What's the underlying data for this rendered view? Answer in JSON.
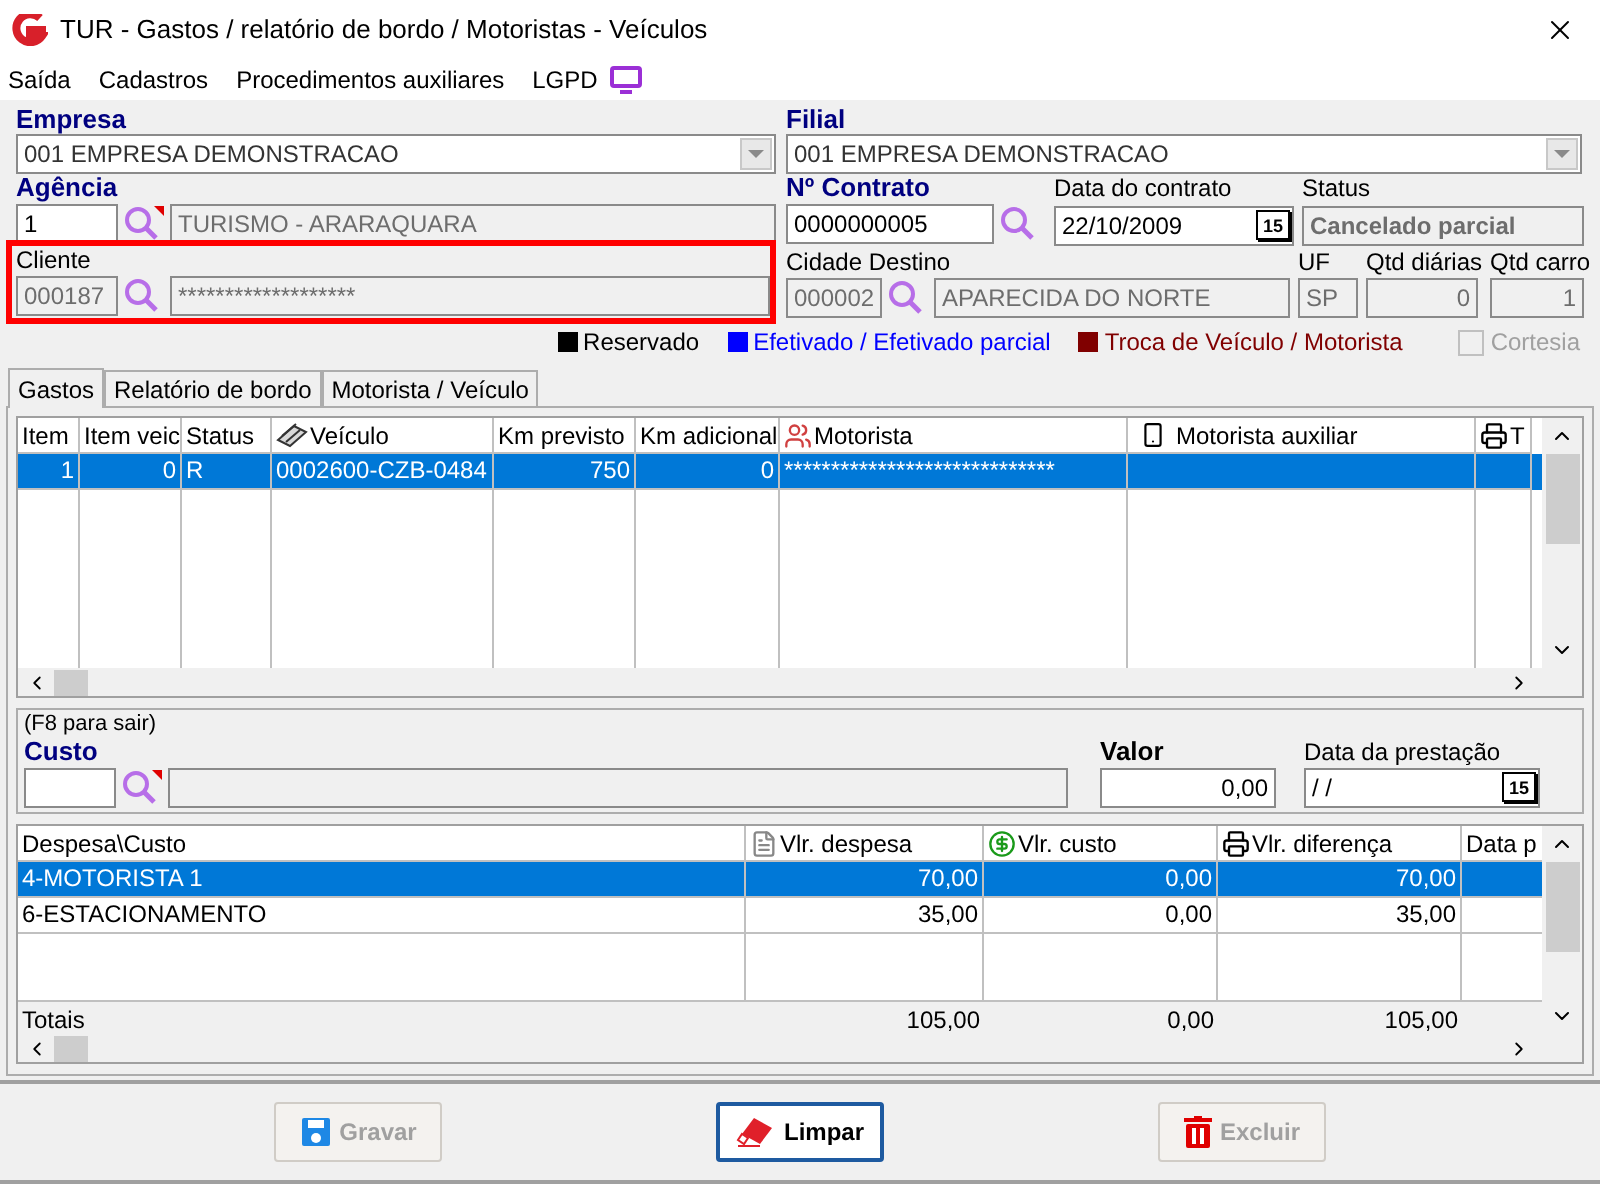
{
  "window": {
    "title": "TUR - Gastos / relatório de bordo / Motoristas - Veículos"
  },
  "menu": [
    {
      "label": "Saída"
    },
    {
      "label": "Cadastros"
    },
    {
      "label": "Procedimentos auxiliares"
    },
    {
      "label": "LGPD"
    }
  ],
  "empresa": {
    "label": "Empresa",
    "value": "001 EMPRESA DEMONSTRACAO"
  },
  "filial": {
    "label": "Filial",
    "value": "001 EMPRESA DEMONSTRACAO"
  },
  "agencia": {
    "label": "Agência",
    "code": "1",
    "name": "TURISMO - ARARAQUARA"
  },
  "contrato": {
    "label": "Nº Contrato",
    "value": "0000000005"
  },
  "data_contrato": {
    "label": "Data do contrato",
    "value": "22/10/2009",
    "calendar": "15"
  },
  "status": {
    "label": "Status",
    "value": "Cancelado parcial"
  },
  "cliente": {
    "label": "Cliente",
    "code": "000187",
    "name": "*******************"
  },
  "cidade_destino": {
    "label": "Cidade Destino",
    "code": "000002",
    "name": "APARECIDA DO NORTE"
  },
  "uf": {
    "label": "UF",
    "value": "SP"
  },
  "qtd_diarias": {
    "label": "Qtd diárias",
    "value": "0"
  },
  "qtd_carro": {
    "label": "Qtd carro",
    "value": "1"
  },
  "legend": [
    {
      "label": "Reservado",
      "color": "#000000"
    },
    {
      "label": "Efetivado / Efetivado parcial",
      "color": "#0000ff"
    },
    {
      "label": "Troca de Veículo / Motorista",
      "color": "#800000"
    }
  ],
  "cortesia": {
    "label": "Cortesia",
    "checked": false,
    "disabled": true
  },
  "tabs": [
    {
      "label": "Gastos",
      "selected": true
    },
    {
      "label": "Relatório de bordo",
      "selected": false
    },
    {
      "label": "Motorista / Veículo",
      "selected": false
    }
  ],
  "vehicles_table": {
    "columns": [
      "Item",
      "Item veic",
      "Status",
      "Veículo",
      "Km previsto",
      "Km adicional",
      "Motorista",
      "Motorista auxiliar",
      "T"
    ],
    "rows": [
      {
        "selected": true,
        "cells": [
          "1",
          "0",
          "R",
          "0002600-CZB-0484",
          "750",
          "0",
          "*****************************",
          "",
          ""
        ]
      }
    ]
  },
  "custo_panel": {
    "hint": "(F8 para sair)",
    "custo_label": "Custo",
    "valor_label": "Valor",
    "valor": "0,00",
    "data_label": "Data da prestação",
    "data": "/ /",
    "calendar": "15"
  },
  "expenses_table": {
    "columns": [
      "Despesa\\Custo",
      "Vlr. despesa",
      "Vlr. custo",
      "Vlr. diferença",
      "Data p"
    ],
    "rows": [
      {
        "selected": true,
        "cells": [
          "4-MOTORISTA 1",
          "70,00",
          "0,00",
          "70,00",
          ""
        ]
      },
      {
        "selected": false,
        "cells": [
          "6-ESTACIONAMENTO",
          "35,00",
          "0,00",
          "35,00",
          ""
        ]
      }
    ],
    "totals": {
      "label": "Totais",
      "values": [
        "105,00",
        "0,00",
        "105,00"
      ]
    }
  },
  "buttons": [
    {
      "label": "Gravar",
      "disabled": true,
      "default": false
    },
    {
      "label": "Limpar",
      "disabled": false,
      "default": true
    },
    {
      "label": "Excluir",
      "disabled": true,
      "default": false
    }
  ]
}
